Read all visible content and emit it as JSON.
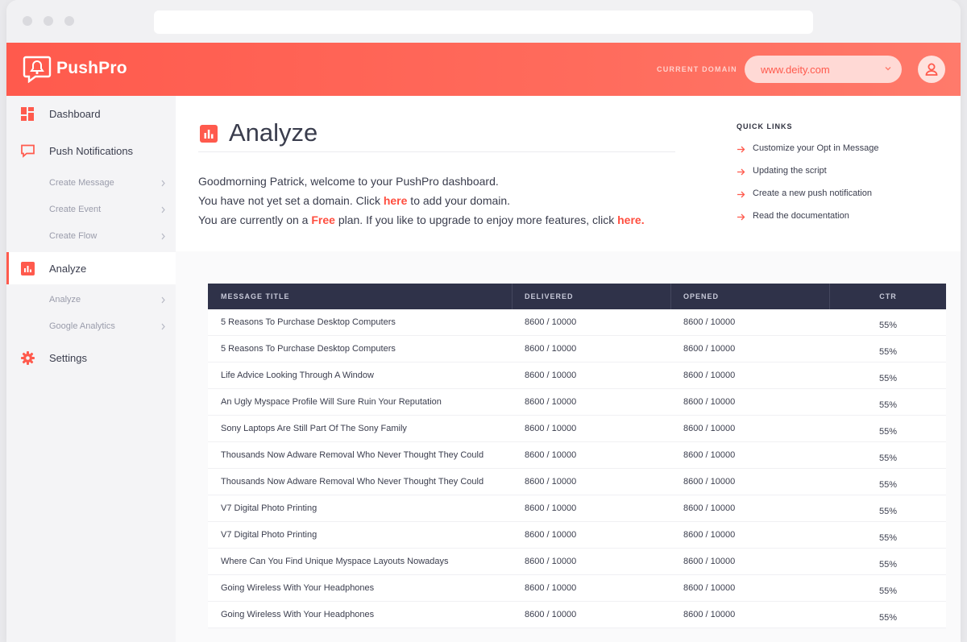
{
  "app": {
    "name": "PushPro"
  },
  "header": {
    "domain_label": "CURRENT DOMAIN",
    "domain_value": "www.deity.com"
  },
  "sidebar": {
    "items": [
      {
        "label": "Dashboard",
        "icon": "dashboard-icon"
      },
      {
        "label": "Push Notifications",
        "icon": "chat-bubble-icon"
      },
      {
        "label": "Create Message"
      },
      {
        "label": "Create Event"
      },
      {
        "label": "Create Flow"
      },
      {
        "label": "Analyze",
        "icon": "bar-chart-icon",
        "active": true
      },
      {
        "label": "Analyze"
      },
      {
        "label": "Google Analytics"
      },
      {
        "label": "Settings",
        "icon": "gear-icon"
      }
    ]
  },
  "main": {
    "title": "Analyze",
    "welcome_line1": "Goodmorning Patrick, welcome to your PushPro dashboard.",
    "welcome_line2_pre": "You have not yet set a domain. Click ",
    "welcome_line2_link": "here",
    "welcome_line2_post": " to add your domain.",
    "welcome_line3_pre": "You are currently on a ",
    "welcome_line3_plan": "Free",
    "welcome_line3_mid": " plan. If you like to upgrade to enjoy more features, click ",
    "welcome_line3_link": "here."
  },
  "quick_links": {
    "title": "QUICK LINKS",
    "items": [
      "Customize your Opt in Message",
      "Updating the script",
      "Create a new push notification",
      "Read the documentation"
    ]
  },
  "table": {
    "columns": [
      "MESSAGE TITLE",
      "DELIVERED",
      "OPENED",
      "CTR"
    ],
    "rows": [
      [
        "5 Reasons To Purchase Desktop Computers",
        "8600 / 10000",
        "8600 / 10000",
        "55%"
      ],
      [
        "5 Reasons To Purchase Desktop Computers",
        "8600 / 10000",
        "8600 / 10000",
        "55%"
      ],
      [
        "Life Advice Looking Through A Window",
        "8600 / 10000",
        "8600 / 10000",
        "55%"
      ],
      [
        "An Ugly Myspace Profile Will Sure Ruin Your Reputation",
        "8600 / 10000",
        "8600 / 10000",
        "55%"
      ],
      [
        "Sony Laptops Are Still Part Of The Sony Family",
        "8600 / 10000",
        "8600 / 10000",
        "55%"
      ],
      [
        "Thousands Now Adware Removal Who Never Thought They Could",
        "8600 / 10000",
        "8600 / 10000",
        "55%"
      ],
      [
        "Thousands Now Adware Removal Who Never Thought They Could",
        "8600 / 10000",
        "8600 / 10000",
        "55%"
      ],
      [
        "V7 Digital Photo Printing",
        "8600 / 10000",
        "8600 / 10000",
        "55%"
      ],
      [
        "V7 Digital Photo Printing",
        "8600 / 10000",
        "8600 / 10000",
        "55%"
      ],
      [
        "Where Can You Find Unique Myspace Layouts Nowadays",
        "8600 / 10000",
        "8600 / 10000",
        "55%"
      ],
      [
        "Going Wireless With Your Headphones",
        "8600 / 10000",
        "8600 / 10000",
        "55%"
      ],
      [
        "Going Wireless With Your Headphones",
        "8600 / 10000",
        "8600 / 10000",
        "55%"
      ]
    ]
  },
  "colors": {
    "accent": "#ff5a4d",
    "header_dark": "#2f3249",
    "text": "#3a3d4d"
  }
}
